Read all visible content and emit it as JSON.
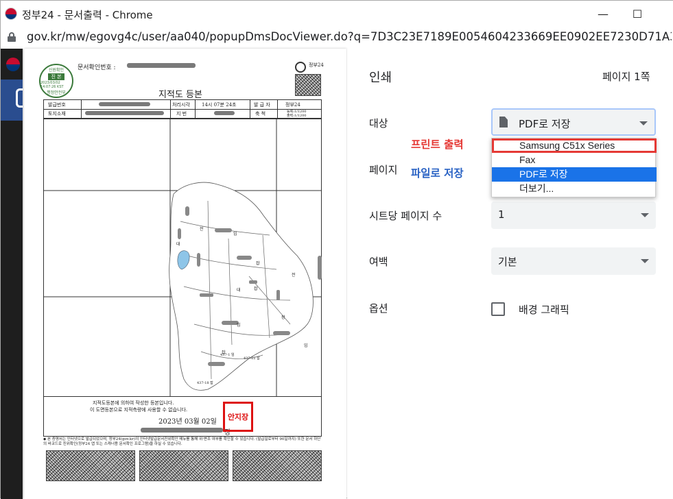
{
  "window": {
    "title": "정부24 - 문서출력 - Chrome",
    "minimize_glyph": "—",
    "maximize_glyph": "☐"
  },
  "address_bar": {
    "url": "gov.kr/mw/egovg4c/user/aa040/popupDmsDocViewer.do?q=7D3C23E7189E0054604233669EE0902EE7230D71A35B93"
  },
  "document": {
    "confirm_label": "문서확인번호 :",
    "title": "지적도 등본",
    "header_row1": [
      "발급번호",
      "처리시각",
      "14시 07분 24초",
      "발 급 자",
      "정부24"
    ],
    "header_row2": [
      "토지소재",
      "지 번",
      "축 척"
    ],
    "scale_text": [
      "등록:1/1200",
      "출력:1/1200"
    ],
    "corner_label": "정부24",
    "parcel_labels": [
      "전",
      "임",
      "잡",
      "대",
      "잡",
      "임",
      "전",
      "장",
      "대",
      "임",
      "잡",
      "437-1 임",
      "437-22 잡",
      "437-18 잡"
    ],
    "footer_line1": "지적도등본에 의하여 작성한 등본입니다.",
    "footer_line2": "이 도면등본으로 지적측량에 사용할 수 없습니다.",
    "date": "2023년 03월 02일",
    "chief_suffix": "장",
    "notice": "◆ 본 증명서는 인터넷으로 발급되었으며, 정부24(gov.kr)의 인터넷발급문서진위확인 메뉴를 통해 위·변조 여부를 확인할 수 있습니다. (발급일로부터 90일까지) 또한 문서 하단의 바코드로 진위확인(정부24 앱 또는 스캐너용 문서확인 프로그램)을 하실 수 있습니다.",
    "green_seal": [
      "신원확인",
      "진 본",
      "2023/03/02 14:07:26 KST",
      "행정안전부"
    ],
    "red_stamp": "안지장"
  },
  "print_panel": {
    "heading": "인쇄",
    "page_count": "페이지 1쪽",
    "destination_label": "대상",
    "destination_value": "PDF로 저장",
    "pages_label": "페이지",
    "pages_per_sheet_label": "시트당 페이지 수",
    "pages_per_sheet_value": "1",
    "margins_label": "여백",
    "margins_value": "기본",
    "options_label": "옵션",
    "background_graphics_label": "배경 그래픽",
    "dropdown_options": [
      "Samsung C51x Series",
      "Fax",
      "PDF로 저장",
      "더보기..."
    ],
    "annotation_print": "프린트 출력",
    "annotation_file": "파일로 저장"
  },
  "colors": {
    "annotation_print": "#e53935",
    "annotation_file": "#2962c4",
    "selected_option": "#1a73e8"
  }
}
